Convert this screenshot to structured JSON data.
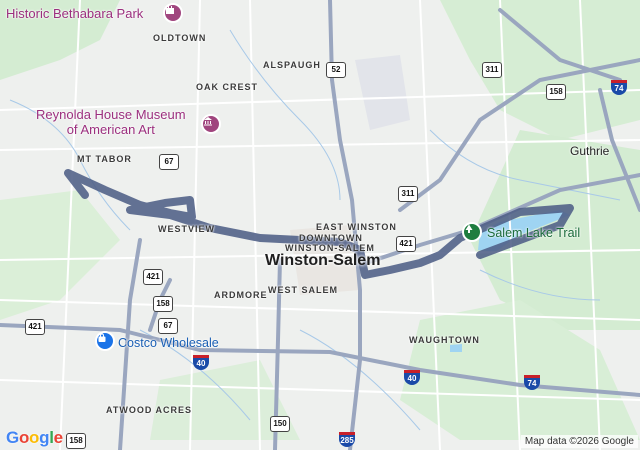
{
  "map": {
    "city": "Winston-Salem",
    "neighborhoods": [
      "OLDTOWN",
      "ALSPAUGH",
      "OAK CREST",
      "MT TABOR",
      "WESTVIEW",
      "EAST WINSTON",
      "DOWNTOWN",
      "WINSTON-SALEM",
      "ARDMORE",
      "WEST SALEM",
      "WAUGHTOWN",
      "ATWOOD ACRES"
    ],
    "town": "Guthrie",
    "pois": {
      "bethabara": "Historic Bethabara Park",
      "reynolda_line1": "Reynolda House Museum",
      "reynolda_line2": "of American Art",
      "costco": "Costco Wholesale",
      "salem_lake": "Salem Lake Trail"
    },
    "route_shields": [
      "52",
      "311",
      "158",
      "74",
      "67",
      "311",
      "421",
      "421",
      "158",
      "67",
      "40",
      "40",
      "74",
      "150",
      "285",
      "158",
      "421"
    ],
    "interstate_shields": [
      "74",
      "40",
      "40",
      "74",
      "285"
    ],
    "us_shields": [
      "52",
      "311",
      "158",
      "67",
      "311",
      "421",
      "421",
      "158",
      "67",
      "150",
      "158",
      "421"
    ],
    "attribution": "Map data ©2026 Google",
    "logo": [
      "G",
      "o",
      "o",
      "g",
      "l",
      "e"
    ],
    "logo_colors": [
      "#4285F4",
      "#EA4335",
      "#FBBC05",
      "#4285F4",
      "#34A853",
      "#EA4335"
    ],
    "route_color": "#4f5f86",
    "icons": [
      "castle-icon",
      "museum-icon",
      "shopping-bag-icon",
      "tree-icon"
    ]
  }
}
